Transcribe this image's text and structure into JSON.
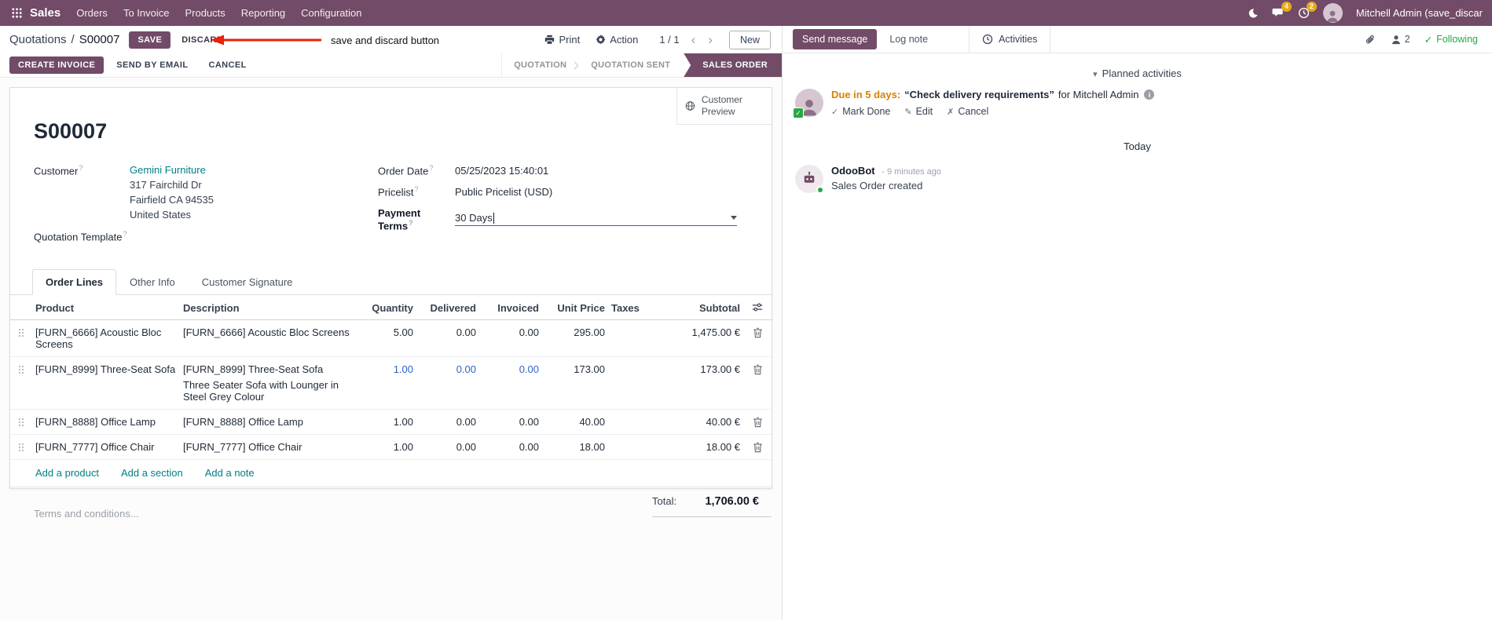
{
  "colors": {
    "brand": "#714B67",
    "link": "#017E84",
    "edited": "#2C63C9",
    "arrow": "#E8220C",
    "due": "#D78100"
  },
  "icons": {
    "help": "?",
    "caret_down": "▾",
    "chevron_left": "‹",
    "chevron_right": "›",
    "check": "✓",
    "pencil": "✎",
    "cross": "✗",
    "info": "i"
  },
  "navbar": {
    "app_name": "Sales",
    "menus": [
      "Orders",
      "To Invoice",
      "Products",
      "Reporting",
      "Configuration"
    ],
    "messages_badge": "4",
    "activities_badge": "2",
    "user": "Mitchell Admin (save_discar"
  },
  "control_panel": {
    "breadcrumb": "Quotations",
    "separator": "/",
    "record": "S00007",
    "save": "SAVE",
    "discard": "DISCARD",
    "annotation": "save and discard button",
    "print": "Print",
    "action": "Action",
    "pager": "1 / 1",
    "new": "New"
  },
  "statusbar": {
    "create_invoice": "CREATE INVOICE",
    "send_by_email": "SEND BY EMAIL",
    "cancel": "CANCEL",
    "steps": [
      {
        "label": "QUOTATION",
        "active": false
      },
      {
        "label": "QUOTATION SENT",
        "active": false
      },
      {
        "label": "SALES ORDER",
        "active": true
      }
    ]
  },
  "form": {
    "preview_button": "Customer Preview",
    "title": "S00007",
    "labels": {
      "customer": "Customer",
      "quotation_template": "Quotation Template",
      "order_date": "Order Date",
      "pricelist": "Pricelist",
      "payment_terms": "Payment Terms"
    },
    "values": {
      "customer": "Gemini Furniture",
      "address": [
        "317 Fairchild Dr",
        "Fairfield CA 94535",
        "United States"
      ],
      "order_date": "05/25/2023 15:40:01",
      "pricelist": "Public Pricelist (USD)",
      "payment_terms": "30 Days"
    },
    "tabs": [
      "Order Lines",
      "Other Info",
      "Customer Signature"
    ],
    "table": {
      "headers": [
        "Product",
        "Description",
        "Quantity",
        "Delivered",
        "Invoiced",
        "Unit Price",
        "Taxes",
        "Subtotal"
      ],
      "rows": [
        {
          "product": "[FURN_6666] Acoustic Bloc Screens",
          "description": "[FURN_6666] Acoustic Bloc Screens",
          "description2": "",
          "quantity": "5.00",
          "delivered": "0.00",
          "invoiced": "0.00",
          "unit_price": "295.00",
          "taxes": "",
          "subtotal": "1,475.00 €"
        },
        {
          "product": "[FURN_8999] Three-Seat Sofa",
          "description": "[FURN_8999] Three-Seat Sofa",
          "description2": "Three Seater Sofa with Lounger in Steel Grey Colour",
          "quantity": "1.00",
          "delivered": "0.00",
          "invoiced": "0.00",
          "unit_price": "173.00",
          "taxes": "",
          "subtotal": "173.00 €"
        },
        {
          "product": "[FURN_8888] Office Lamp",
          "description": "[FURN_8888] Office Lamp",
          "description2": "",
          "quantity": "1.00",
          "delivered": "0.00",
          "invoiced": "0.00",
          "unit_price": "40.00",
          "taxes": "",
          "subtotal": "40.00 €"
        },
        {
          "product": "[FURN_7777] Office Chair",
          "description": "[FURN_7777] Office Chair",
          "description2": "",
          "quantity": "1.00",
          "delivered": "0.00",
          "invoiced": "0.00",
          "unit_price": "18.00",
          "taxes": "",
          "subtotal": "18.00 €"
        }
      ],
      "links": [
        "Add a product",
        "Add a section",
        "Add a note"
      ]
    },
    "terms_placeholder": "Terms and conditions...",
    "total_label": "Total:",
    "total_value": "1,706.00 €"
  },
  "chatter": {
    "send_message": "Send message",
    "log_note": "Log note",
    "activities": "Activities",
    "followers_count": "2",
    "following": "Following",
    "planned_header": "Planned activities",
    "activity": {
      "due": "Due in 5 days:",
      "summary": "“Check delivery requirements”",
      "assignee": "for Mitchell Admin",
      "mark_done": "Mark Done",
      "edit": "Edit",
      "cancel": "Cancel"
    },
    "today": "Today",
    "message": {
      "author": "OdooBot",
      "time": "- 9 minutes ago",
      "body": "Sales Order created"
    }
  }
}
